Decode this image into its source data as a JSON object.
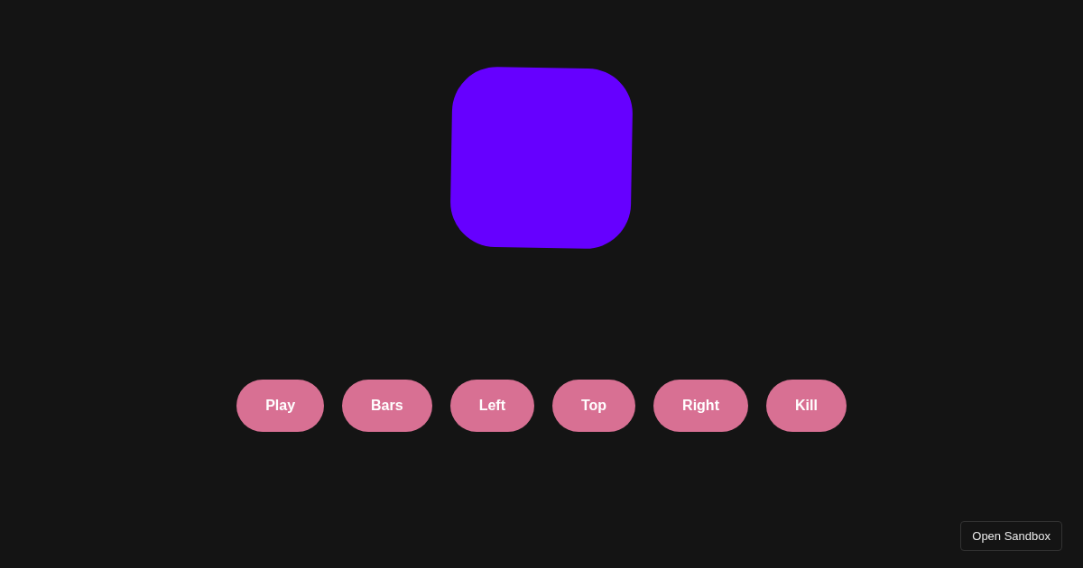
{
  "buttons": [
    "Play",
    "Bars",
    "Left",
    "Top",
    "Right",
    "Kill"
  ],
  "sandbox_link": {
    "label": "Open Sandbox"
  }
}
